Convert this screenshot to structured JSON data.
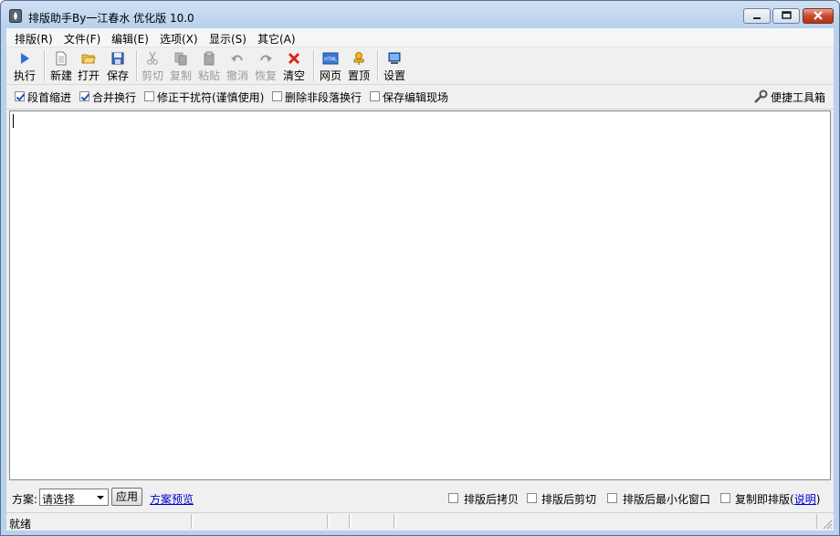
{
  "window": {
    "title": "排版助手By一江春水 优化版 10.0"
  },
  "menu": [
    "排版(R)",
    "文件(F)",
    "编辑(E)",
    "选项(X)",
    "显示(S)",
    "其它(A)"
  ],
  "toolbar": {
    "execute": "执行",
    "new": "新建",
    "open": "打开",
    "save": "保存",
    "cut": "剪切",
    "copy": "复制",
    "paste": "粘贴",
    "undo": "撤消",
    "redo": "恢复",
    "clear": "清空",
    "web": "网页",
    "top": "置顶",
    "settings": "设置",
    "web_icon_text": "HTML"
  },
  "options": {
    "indent": {
      "label": "段首缩进",
      "checked": true
    },
    "merge": {
      "label": "合并换行",
      "checked": true
    },
    "fix": {
      "label": "修正干扰符(谨慎使用)",
      "checked": false
    },
    "delete_breaks": {
      "label": "删除非段落换行",
      "checked": false
    },
    "save_state": {
      "label": "保存编辑现场",
      "checked": false
    },
    "toolbox": "便捷工具箱"
  },
  "editor": {
    "value": ""
  },
  "bottom": {
    "scheme_label": "方案:",
    "scheme_value": "请选择",
    "apply": "应用",
    "preview": "方案预览",
    "copy_after": "排版后拷贝",
    "cut_after": "排版后剪切",
    "minimize_after": "排版后最小化窗口",
    "copy_then_format": "复制即排版(",
    "help": "说明",
    "close_paren": ")"
  },
  "status": {
    "ready": "就绪"
  }
}
